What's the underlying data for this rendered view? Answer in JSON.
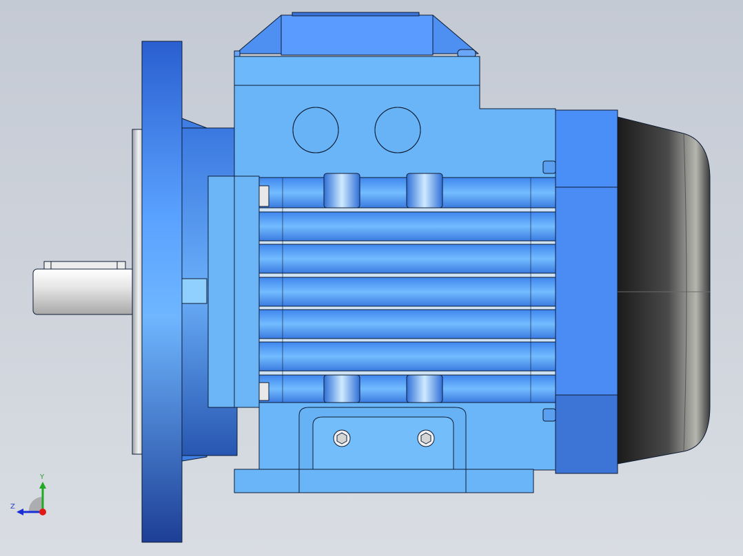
{
  "viewport": {
    "model": "electric-motor-with-flange",
    "background": "#c9ced6",
    "colors": {
      "body_blue": "#6ab7f8",
      "dark_blue": "#1f58b8",
      "flange_blue": "#4d90f0",
      "fan_cover": "#2a2a2a",
      "shaft": "#d8d8d8",
      "outline": "#0d1b33"
    }
  },
  "triad": {
    "y_label": "Y",
    "z_label": "Z",
    "x_color": "#e01818",
    "y_color": "#22a822",
    "z_color": "#1a2ed6"
  }
}
